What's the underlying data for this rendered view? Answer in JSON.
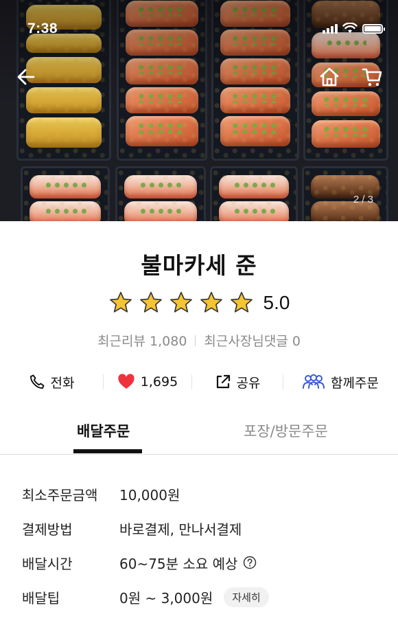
{
  "status_bar": {
    "time": "7:38",
    "signal_icon": "signal-bars-icon",
    "wifi_icon": "wifi-icon",
    "battery_icon": "battery-icon"
  },
  "header": {
    "back_icon": "back-arrow-icon",
    "home_icon": "home-icon",
    "cart_icon": "cart-icon",
    "photo_indicator": "2 / 3"
  },
  "store": {
    "name": "불마카세 준",
    "rating": "5.0",
    "star_count": 5,
    "recent_reviews": "최근리뷰 1,080",
    "owner_comments": "최근사장님댓글 0"
  },
  "actions": {
    "call": "전화",
    "likes": "1,695",
    "share": "공유",
    "group_order": "함께주문"
  },
  "tabs": {
    "delivery": "배달주문",
    "pickup": "포장/방문주문"
  },
  "info": {
    "min_order_label": "최소주문금액",
    "min_order_value": "10,000원",
    "payment_label": "결제방법",
    "payment_value": "바로결제, 만나서결제",
    "delivery_time_label": "배달시간",
    "delivery_time_value": "60~75분 소요 예상",
    "delivery_tip_label": "배달팁",
    "delivery_tip_value": "0원 ~ 3,000원",
    "detail_button": "자세히"
  },
  "colors": {
    "star": "#f4c431",
    "heart": "#f0323c",
    "group_icon": "#3b5bd6",
    "text": "#111111",
    "muted": "#8a8a8a"
  }
}
